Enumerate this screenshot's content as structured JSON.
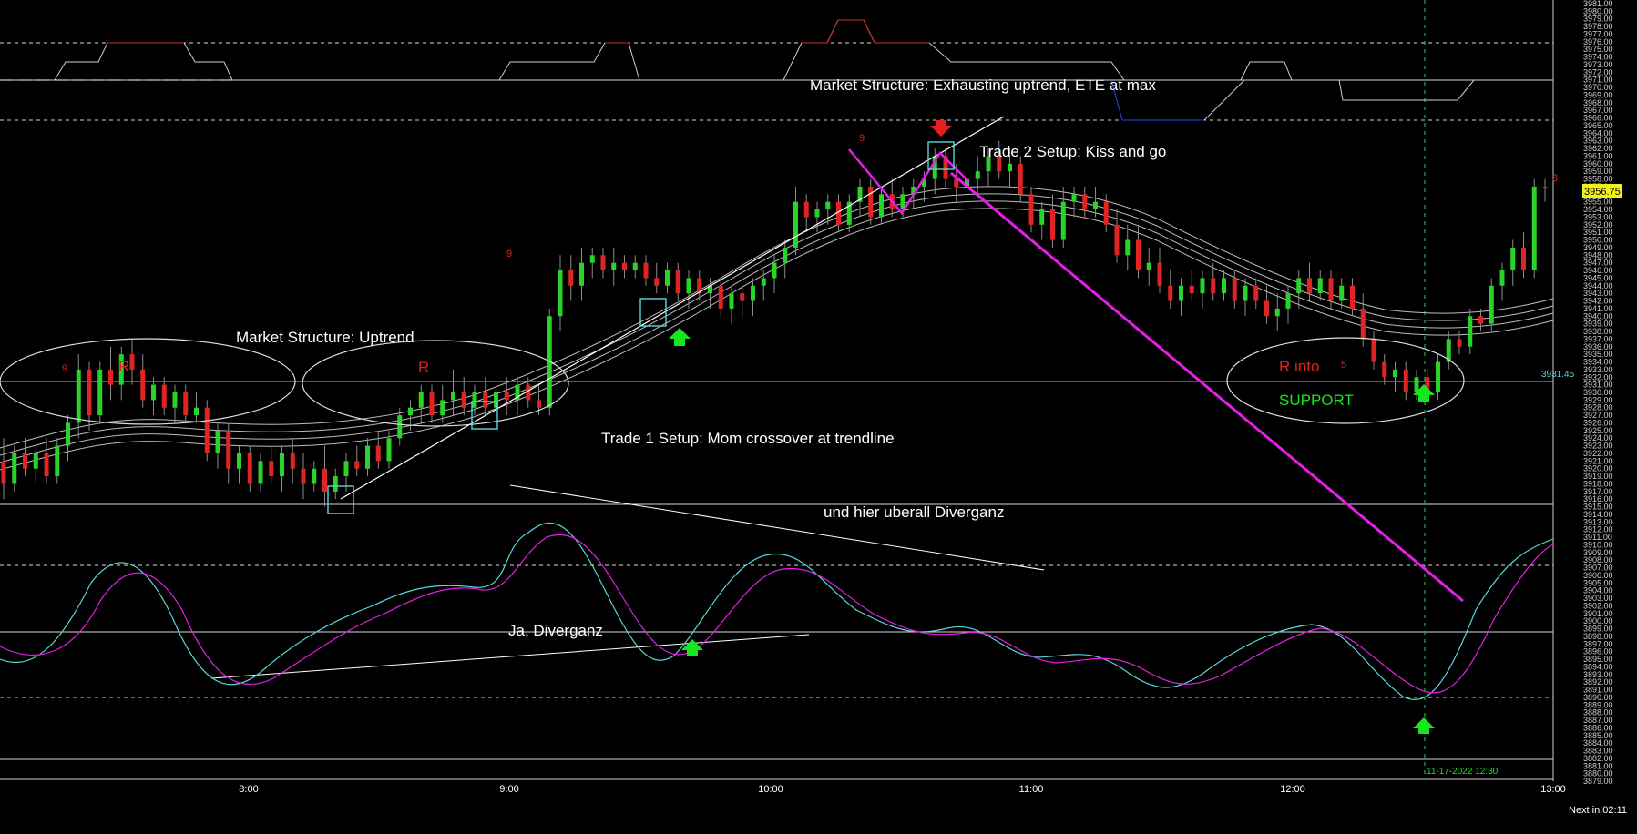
{
  "chart_data": {
    "type": "candlestick",
    "instrument_price_scale": {
      "min": 3879.0,
      "max": 3981.0,
      "label_step": 1.0
    },
    "time_axis": {
      "ticks": [
        "8:00",
        "9:00",
        "10:00",
        "11:00",
        "12:00",
        "13:00"
      ],
      "crosshair_label": "11-17-2022 12:30"
    },
    "current_price": "3956.75",
    "horizontal_level": "3931.45",
    "footer_text": "Next in 02:11",
    "annotations": {
      "market_structure_uptrend": "Market Structure:  Uptrend",
      "market_structure_exhausting": "Market Structure:  Exhausting uptrend, ETE at max",
      "trade2_setup": "Trade 2 Setup:  Kiss and go",
      "trade1_setup": "Trade 1 Setup:  Mom crossover at trendline",
      "divergence_everywhere": "und hier uberall Diverganz",
      "ja_divergence": "Ja, Diverganz",
      "r1": "R",
      "r2": "R",
      "r_into": "R into",
      "support": "SUPPORT",
      "nine_a": "9",
      "nine_b": "9",
      "nine_c": "9",
      "five": "5",
      "three": "3"
    },
    "candles": [
      {
        "o": 3921,
        "h": 3924,
        "l": 3916,
        "c": 3918
      },
      {
        "o": 3918,
        "h": 3923,
        "l": 3917,
        "c": 3922
      },
      {
        "o": 3922,
        "h": 3924,
        "l": 3919,
        "c": 3920
      },
      {
        "o": 3920,
        "h": 3923,
        "l": 3918,
        "c": 3922
      },
      {
        "o": 3922,
        "h": 3924,
        "l": 3918,
        "c": 3919
      },
      {
        "o": 3919,
        "h": 3924,
        "l": 3918,
        "c": 3923
      },
      {
        "o": 3923,
        "h": 3927,
        "l": 3921,
        "c": 3926
      },
      {
        "o": 3926,
        "h": 3935,
        "l": 3924,
        "c": 3933
      },
      {
        "o": 3933,
        "h": 3934,
        "l": 3925,
        "c": 3927
      },
      {
        "o": 3927,
        "h": 3934,
        "l": 3926,
        "c": 3933
      },
      {
        "o": 3933,
        "h": 3936,
        "l": 3929,
        "c": 3931
      },
      {
        "o": 3931,
        "h": 3936,
        "l": 3929,
        "c": 3935
      },
      {
        "o": 3935,
        "h": 3937,
        "l": 3931,
        "c": 3933
      },
      {
        "o": 3933,
        "h": 3935,
        "l": 3928,
        "c": 3929
      },
      {
        "o": 3929,
        "h": 3932,
        "l": 3927,
        "c": 3931
      },
      {
        "o": 3931,
        "h": 3932,
        "l": 3927,
        "c": 3928
      },
      {
        "o": 3928,
        "h": 3931,
        "l": 3926,
        "c": 3930
      },
      {
        "o": 3930,
        "h": 3931,
        "l": 3926,
        "c": 3927
      },
      {
        "o": 3927,
        "h": 3930,
        "l": 3926,
        "c": 3928
      },
      {
        "o": 3928,
        "h": 3929,
        "l": 3921,
        "c": 3922
      },
      {
        "o": 3922,
        "h": 3926,
        "l": 3920,
        "c": 3925
      },
      {
        "o": 3925,
        "h": 3926,
        "l": 3918,
        "c": 3920
      },
      {
        "o": 3920,
        "h": 3923,
        "l": 3918,
        "c": 3922
      },
      {
        "o": 3922,
        "h": 3923,
        "l": 3917,
        "c": 3918
      },
      {
        "o": 3918,
        "h": 3922,
        "l": 3917,
        "c": 3921
      },
      {
        "o": 3921,
        "h": 3923,
        "l": 3918,
        "c": 3919
      },
      {
        "o": 3919,
        "h": 3923,
        "l": 3917,
        "c": 3922
      },
      {
        "o": 3922,
        "h": 3924,
        "l": 3918,
        "c": 3920
      },
      {
        "o": 3920,
        "h": 3922,
        "l": 3916,
        "c": 3918
      },
      {
        "o": 3918,
        "h": 3921,
        "l": 3917,
        "c": 3920
      },
      {
        "o": 3920,
        "h": 3923,
        "l": 3915,
        "c": 3917
      },
      {
        "o": 3917,
        "h": 3920,
        "l": 3916,
        "c": 3919
      },
      {
        "o": 3919,
        "h": 3922,
        "l": 3917,
        "c": 3921
      },
      {
        "o": 3921,
        "h": 3923,
        "l": 3919,
        "c": 3920
      },
      {
        "o": 3920,
        "h": 3924,
        "l": 3919,
        "c": 3923
      },
      {
        "o": 3923,
        "h": 3925,
        "l": 3920,
        "c": 3921
      },
      {
        "o": 3921,
        "h": 3925,
        "l": 3920,
        "c": 3924
      },
      {
        "o": 3924,
        "h": 3928,
        "l": 3923,
        "c": 3927
      },
      {
        "o": 3927,
        "h": 3929,
        "l": 3925,
        "c": 3928
      },
      {
        "o": 3928,
        "h": 3931,
        "l": 3926,
        "c": 3930
      },
      {
        "o": 3930,
        "h": 3931,
        "l": 3926,
        "c": 3927
      },
      {
        "o": 3927,
        "h": 3931,
        "l": 3926,
        "c": 3929
      },
      {
        "o": 3929,
        "h": 3933,
        "l": 3927,
        "c": 3930
      },
      {
        "o": 3930,
        "h": 3932,
        "l": 3927,
        "c": 3928
      },
      {
        "o": 3928,
        "h": 3931,
        "l": 3927,
        "c": 3930
      },
      {
        "o": 3930,
        "h": 3932,
        "l": 3927,
        "c": 3928
      },
      {
        "o": 3928,
        "h": 3931,
        "l": 3927,
        "c": 3930
      },
      {
        "o": 3930,
        "h": 3932,
        "l": 3927,
        "c": 3929
      },
      {
        "o": 3929,
        "h": 3932,
        "l": 3927,
        "c": 3931
      },
      {
        "o": 3931,
        "h": 3932,
        "l": 3928,
        "c": 3929
      },
      {
        "o": 3929,
        "h": 3931,
        "l": 3927,
        "c": 3928
      },
      {
        "o": 3928,
        "h": 3941,
        "l": 3927,
        "c": 3940
      },
      {
        "o": 3940,
        "h": 3948,
        "l": 3938,
        "c": 3946
      },
      {
        "o": 3946,
        "h": 3948,
        "l": 3942,
        "c": 3944
      },
      {
        "o": 3944,
        "h": 3949,
        "l": 3942,
        "c": 3947
      },
      {
        "o": 3947,
        "h": 3949,
        "l": 3945,
        "c": 3948
      },
      {
        "o": 3948,
        "h": 3949,
        "l": 3945,
        "c": 3946
      },
      {
        "o": 3946,
        "h": 3949,
        "l": 3944,
        "c": 3947
      },
      {
        "o": 3947,
        "h": 3948,
        "l": 3945,
        "c": 3946
      },
      {
        "o": 3946,
        "h": 3948,
        "l": 3945,
        "c": 3947
      },
      {
        "o": 3947,
        "h": 3948,
        "l": 3944,
        "c": 3945
      },
      {
        "o": 3945,
        "h": 3947,
        "l": 3943,
        "c": 3944
      },
      {
        "o": 3944,
        "h": 3947,
        "l": 3943,
        "c": 3946
      },
      {
        "o": 3946,
        "h": 3947,
        "l": 3942,
        "c": 3943
      },
      {
        "o": 3943,
        "h": 3946,
        "l": 3941,
        "c": 3945
      },
      {
        "o": 3945,
        "h": 3946,
        "l": 3942,
        "c": 3943
      },
      {
        "o": 3943,
        "h": 3945,
        "l": 3941,
        "c": 3944
      },
      {
        "o": 3944,
        "h": 3945,
        "l": 3940,
        "c": 3941
      },
      {
        "o": 3941,
        "h": 3944,
        "l": 3939,
        "c": 3943
      },
      {
        "o": 3943,
        "h": 3944,
        "l": 3940,
        "c": 3942
      },
      {
        "o": 3942,
        "h": 3945,
        "l": 3940,
        "c": 3944
      },
      {
        "o": 3944,
        "h": 3946,
        "l": 3942,
        "c": 3945
      },
      {
        "o": 3945,
        "h": 3948,
        "l": 3943,
        "c": 3947
      },
      {
        "o": 3947,
        "h": 3950,
        "l": 3945,
        "c": 3949
      },
      {
        "o": 3949,
        "h": 3957,
        "l": 3948,
        "c": 3955
      },
      {
        "o": 3955,
        "h": 3956,
        "l": 3951,
        "c": 3953
      },
      {
        "o": 3953,
        "h": 3955,
        "l": 3951,
        "c": 3954
      },
      {
        "o": 3954,
        "h": 3956,
        "l": 3952,
        "c": 3955
      },
      {
        "o": 3955,
        "h": 3956,
        "l": 3951,
        "c": 3952
      },
      {
        "o": 3952,
        "h": 3956,
        "l": 3951,
        "c": 3955
      },
      {
        "o": 3955,
        "h": 3958,
        "l": 3953,
        "c": 3957
      },
      {
        "o": 3957,
        "h": 3958,
        "l": 3952,
        "c": 3953
      },
      {
        "o": 3953,
        "h": 3957,
        "l": 3952,
        "c": 3956
      },
      {
        "o": 3956,
        "h": 3958,
        "l": 3953,
        "c": 3954
      },
      {
        "o": 3954,
        "h": 3957,
        "l": 3953,
        "c": 3956
      },
      {
        "o": 3956,
        "h": 3958,
        "l": 3954,
        "c": 3957
      },
      {
        "o": 3957,
        "h": 3959,
        "l": 3955,
        "c": 3958
      },
      {
        "o": 3958,
        "h": 3962,
        "l": 3956,
        "c": 3961
      },
      {
        "o": 3961,
        "h": 3962,
        "l": 3957,
        "c": 3958
      },
      {
        "o": 3958,
        "h": 3960,
        "l": 3955,
        "c": 3957
      },
      {
        "o": 3957,
        "h": 3959,
        "l": 3955,
        "c": 3958
      },
      {
        "o": 3958,
        "h": 3961,
        "l": 3956,
        "c": 3959
      },
      {
        "o": 3959,
        "h": 3962,
        "l": 3957,
        "c": 3961
      },
      {
        "o": 3961,
        "h": 3963,
        "l": 3958,
        "c": 3959
      },
      {
        "o": 3959,
        "h": 3962,
        "l": 3957,
        "c": 3960
      },
      {
        "o": 3960,
        "h": 3961,
        "l": 3955,
        "c": 3956
      },
      {
        "o": 3956,
        "h": 3957,
        "l": 3951,
        "c": 3952
      },
      {
        "o": 3952,
        "h": 3955,
        "l": 3950,
        "c": 3954
      },
      {
        "o": 3954,
        "h": 3956,
        "l": 3949,
        "c": 3950
      },
      {
        "o": 3950,
        "h": 3957,
        "l": 3949,
        "c": 3955
      },
      {
        "o": 3955,
        "h": 3957,
        "l": 3953,
        "c": 3956
      },
      {
        "o": 3956,
        "h": 3957,
        "l": 3953,
        "c": 3954
      },
      {
        "o": 3954,
        "h": 3957,
        "l": 3953,
        "c": 3955
      },
      {
        "o": 3955,
        "h": 3956,
        "l": 3951,
        "c": 3952
      },
      {
        "o": 3952,
        "h": 3954,
        "l": 3947,
        "c": 3948
      },
      {
        "o": 3948,
        "h": 3952,
        "l": 3946,
        "c": 3950
      },
      {
        "o": 3950,
        "h": 3952,
        "l": 3945,
        "c": 3946
      },
      {
        "o": 3946,
        "h": 3949,
        "l": 3944,
        "c": 3947
      },
      {
        "o": 3947,
        "h": 3949,
        "l": 3943,
        "c": 3944
      },
      {
        "o": 3944,
        "h": 3946,
        "l": 3941,
        "c": 3942
      },
      {
        "o": 3942,
        "h": 3945,
        "l": 3940,
        "c": 3944
      },
      {
        "o": 3944,
        "h": 3946,
        "l": 3942,
        "c": 3943
      },
      {
        "o": 3943,
        "h": 3946,
        "l": 3941,
        "c": 3945
      },
      {
        "o": 3945,
        "h": 3947,
        "l": 3942,
        "c": 3943
      },
      {
        "o": 3943,
        "h": 3946,
        "l": 3942,
        "c": 3945
      },
      {
        "o": 3945,
        "h": 3946,
        "l": 3941,
        "c": 3942
      },
      {
        "o": 3942,
        "h": 3945,
        "l": 3940,
        "c": 3944
      },
      {
        "o": 3944,
        "h": 3945,
        "l": 3941,
        "c": 3942
      },
      {
        "o": 3942,
        "h": 3944,
        "l": 3939,
        "c": 3940
      },
      {
        "o": 3940,
        "h": 3943,
        "l": 3938,
        "c": 3941
      },
      {
        "o": 3941,
        "h": 3944,
        "l": 3939,
        "c": 3943
      },
      {
        "o": 3943,
        "h": 3946,
        "l": 3941,
        "c": 3945
      },
      {
        "o": 3945,
        "h": 3947,
        "l": 3942,
        "c": 3943
      },
      {
        "o": 3943,
        "h": 3946,
        "l": 3942,
        "c": 3945
      },
      {
        "o": 3945,
        "h": 3946,
        "l": 3941,
        "c": 3942
      },
      {
        "o": 3942,
        "h": 3945,
        "l": 3941,
        "c": 3944
      },
      {
        "o": 3944,
        "h": 3945,
        "l": 3940,
        "c": 3941
      },
      {
        "o": 3941,
        "h": 3943,
        "l": 3936,
        "c": 3937
      },
      {
        "o": 3937,
        "h": 3938,
        "l": 3933,
        "c": 3934
      },
      {
        "o": 3934,
        "h": 3935,
        "l": 3931,
        "c": 3932
      },
      {
        "o": 3932,
        "h": 3934,
        "l": 3930,
        "c": 3933
      },
      {
        "o": 3933,
        "h": 3934,
        "l": 3929,
        "c": 3930
      },
      {
        "o": 3930,
        "h": 3933,
        "l": 3929,
        "c": 3932
      },
      {
        "o": 3932,
        "h": 3933,
        "l": 3929,
        "c": 3930
      },
      {
        "o": 3930,
        "h": 3935,
        "l": 3929,
        "c": 3934
      },
      {
        "o": 3934,
        "h": 3938,
        "l": 3933,
        "c": 3937
      },
      {
        "o": 3937,
        "h": 3938,
        "l": 3935,
        "c": 3936
      },
      {
        "o": 3936,
        "h": 3941,
        "l": 3935,
        "c": 3940
      },
      {
        "o": 3940,
        "h": 3941,
        "l": 3938,
        "c": 3939
      },
      {
        "o": 3939,
        "h": 3945,
        "l": 3938,
        "c": 3944
      },
      {
        "o": 3944,
        "h": 3947,
        "l": 3942,
        "c": 3946
      },
      {
        "o": 3946,
        "h": 3950,
        "l": 3944,
        "c": 3949
      },
      {
        "o": 3949,
        "h": 3951,
        "l": 3945,
        "c": 3946
      },
      {
        "o": 3946,
        "h": 3958,
        "l": 3945,
        "c": 3957
      },
      {
        "o": 3957,
        "h": 3958,
        "l": 3955,
        "c": 3956.75
      }
    ]
  }
}
